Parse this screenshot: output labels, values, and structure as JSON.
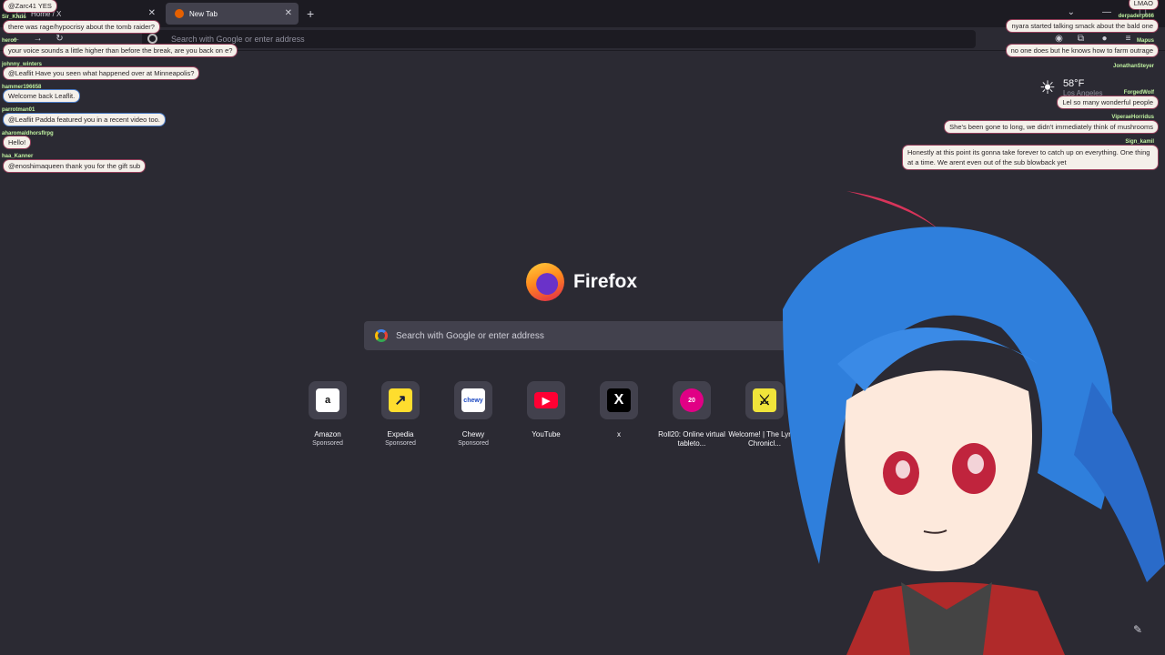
{
  "tabs": [
    {
      "label": "Home / X"
    },
    {
      "label": "New Tab"
    }
  ],
  "toolbar": {
    "url_placeholder": "Search with Google or enter address"
  },
  "newtab": {
    "logo_text": "Firefox",
    "search_placeholder": "Search with Google or enter address",
    "shortcuts": [
      {
        "title": "Amazon",
        "sub": "Sponsored",
        "glyph": "a"
      },
      {
        "title": "Expedia",
        "sub": "Sponsored",
        "glyph": "↗"
      },
      {
        "title": "Chewy",
        "sub": "Sponsored",
        "glyph": "chewy"
      },
      {
        "title": "YouTube",
        "sub": "",
        "glyph": "▶"
      },
      {
        "title": "x",
        "sub": "",
        "glyph": "X"
      },
      {
        "title": "Roll20: Online virtual tableto...",
        "sub": "",
        "glyph": "20"
      },
      {
        "title": "Welcome! | The Lyrian Chronicl...",
        "sub": "",
        "glyph": "⚔"
      }
    ],
    "weather": {
      "temp": "58°F",
      "location": "Los Angeles"
    }
  },
  "chat_left": [
    {
      "user": "",
      "text": "@Zarc41 YES"
    },
    {
      "user": "Sir_Khris",
      "text": "there was rage/hypocrisy about the tomb raider?"
    },
    {
      "user": "hero0",
      "text": "your voice sounds a little higher than before the break, are you back on e?"
    },
    {
      "user": "johnny_winters",
      "text": "@Leaflit Have you seen what happened over at Minneapolis?"
    },
    {
      "user": "hammer196658",
      "text": "Welcome back Leaflit."
    },
    {
      "user": "parrotman01",
      "text": "@Leaflit Padda featured you in a recent video too."
    },
    {
      "user": "aharomaldhorsflrpg",
      "text": "Hello!"
    },
    {
      "user": "haa_Kanner",
      "text": "@enoshimaqueen thank you for the gift sub"
    }
  ],
  "chat_right": [
    {
      "user": "",
      "text": "LMAO"
    },
    {
      "user": "derpaderp666",
      "text": "nyara started talking smack about the bald one"
    },
    {
      "user": "Mapus",
      "text": "no one does but he knows how to farm outrage"
    },
    {
      "user": "JonathanSteyer",
      "text": ""
    },
    {
      "user": "ForgedWolf",
      "text": "Lel so many wonderful people"
    },
    {
      "user": "ViperaeHorridus",
      "text": "She's been gone to long, we didn't immediately think of mushrooms"
    },
    {
      "user": "Sign_kamil",
      "text": "Honestly at this point its gonna take forever to catch up on everything. One thing at a time. We arent even out of the sub blowback yet"
    }
  ],
  "colors": {
    "accent": "#e66000",
    "bg": "#2b2a33",
    "panel": "#42414d"
  }
}
